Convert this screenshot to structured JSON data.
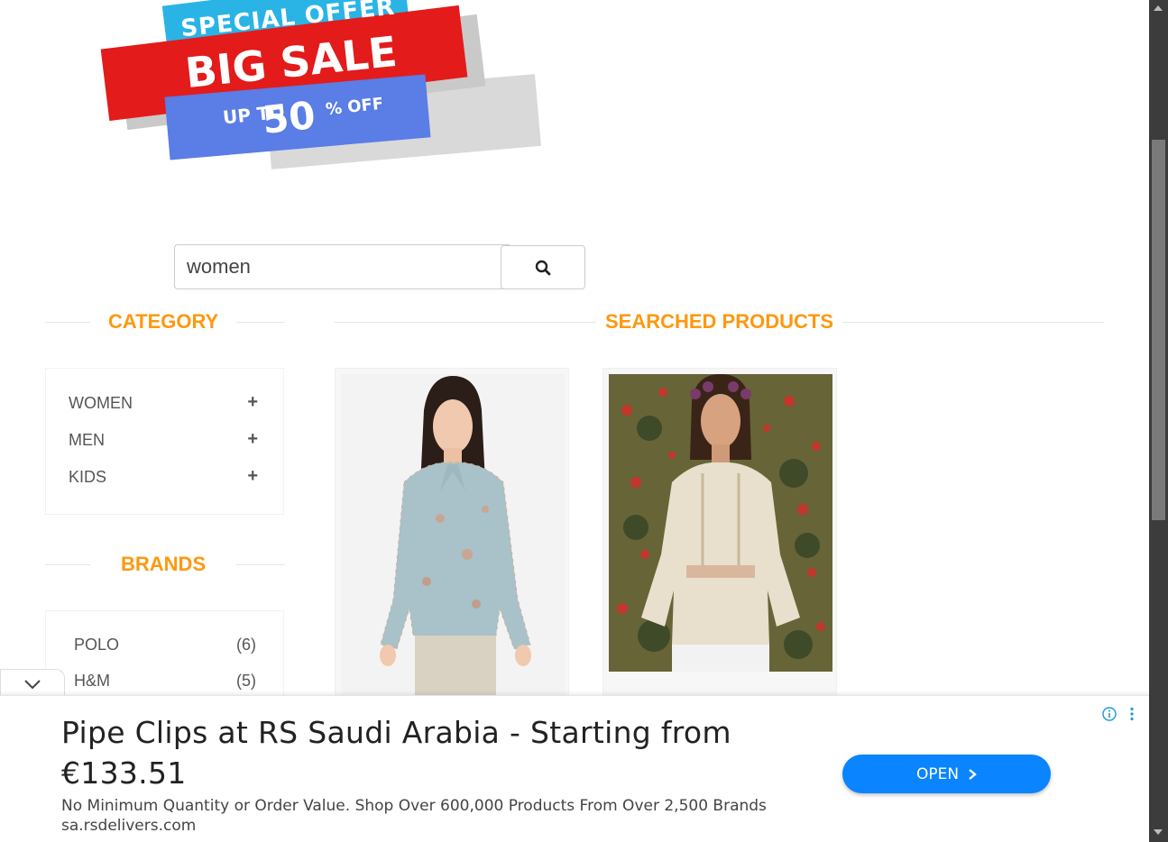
{
  "banner": {
    "line1": "SPECIAL OFFER",
    "line2": "BIG SALE",
    "line3": "UP TO",
    "line4": "50",
    "line5": "% OFF"
  },
  "search": {
    "value": "women",
    "button_icon": "search-icon"
  },
  "sidebar": {
    "category_title": "CATEGORY",
    "categories": [
      {
        "label": "WOMEN",
        "icon": "plus-icon"
      },
      {
        "label": "MEN",
        "icon": "plus-icon"
      },
      {
        "label": "KIDS",
        "icon": "plus-icon"
      }
    ],
    "brands_title": "BRANDS",
    "brands": [
      {
        "label": "POLO",
        "count": "(6)"
      },
      {
        "label": "H&M",
        "count": "(5)"
      }
    ]
  },
  "main": {
    "title": "SEARCHED PRODUCTS"
  },
  "ad": {
    "headline": "Pipe Clips at RS Saudi Arabia - Starting from €133.51",
    "description": "No Minimum Quantity or Order Value. Shop Over 600,000 Products From Over 2,500 Brands",
    "url": "sa.rsdelivers.com",
    "cta": "OPEN",
    "collapse_icon": "chevron-down-icon",
    "info_icon": "info-icon",
    "menu_icon": "more-vertical-icon"
  },
  "colors": {
    "accent": "#fe980f",
    "ad_button": "#0a84ff"
  }
}
